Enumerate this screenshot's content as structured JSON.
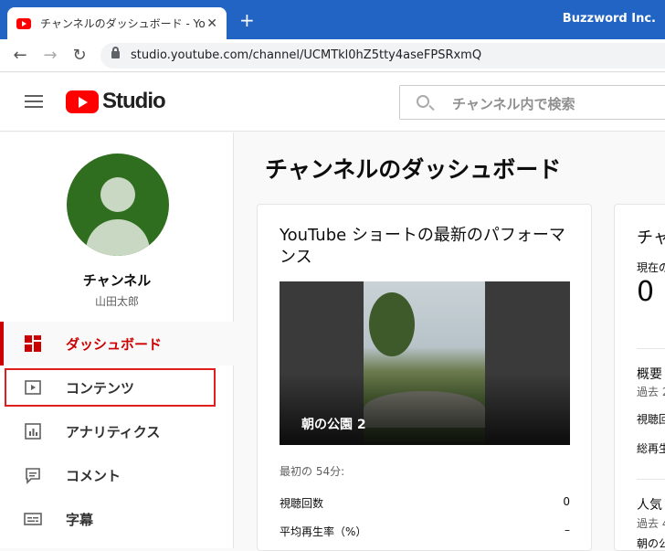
{
  "browser": {
    "tab_title": "チャンネルのダッシュボード - YouTube Studio",
    "new_tab": "+",
    "close": "✕",
    "account": "Buzzword Inc.",
    "back": "←",
    "forward": "→",
    "reload": "↻",
    "url": "studio.youtube.com/channel/UCMTkl0hZ5tty4aseFPSRxmQ"
  },
  "header": {
    "logo_text": "Studio",
    "search_placeholder": "チャンネル内で検索"
  },
  "sidebar": {
    "channel_name": "チャンネル",
    "owner": "山田太郎",
    "items": [
      {
        "label": "ダッシュボード",
        "icon": "dashboard-icon",
        "active": true
      },
      {
        "label": "コンテンツ",
        "icon": "content-icon",
        "active": false
      },
      {
        "label": "アナリティクス",
        "icon": "analytics-icon",
        "active": false
      },
      {
        "label": "コメント",
        "icon": "comment-icon",
        "active": false
      },
      {
        "label": "字幕",
        "icon": "subtitles-icon",
        "active": false
      }
    ]
  },
  "main": {
    "title": "チャンネルのダッシュボード",
    "shorts_card": {
      "title": "YouTube ショートの最新のパフォーマンス",
      "video_title": "朝の公園 2",
      "period": "最初の 54分:",
      "stats": [
        {
          "label": "視聴回数",
          "value": "0"
        },
        {
          "label": "平均再生率（%）",
          "value": "–"
        }
      ]
    },
    "analytics_card": {
      "title_fragment": "チャ",
      "current_fragment": "現在の",
      "count": "0",
      "summary": "概要",
      "past": "過去 2",
      "views_fragment": "視聴回",
      "total_fragment": "総再生",
      "popular": "人気",
      "past2": "過去 4",
      "last_fragment": "朝の公"
    }
  },
  "colors": {
    "accent": "#cc0000",
    "brand_red": "#ff0000",
    "browser_blue": "#2264c4"
  }
}
